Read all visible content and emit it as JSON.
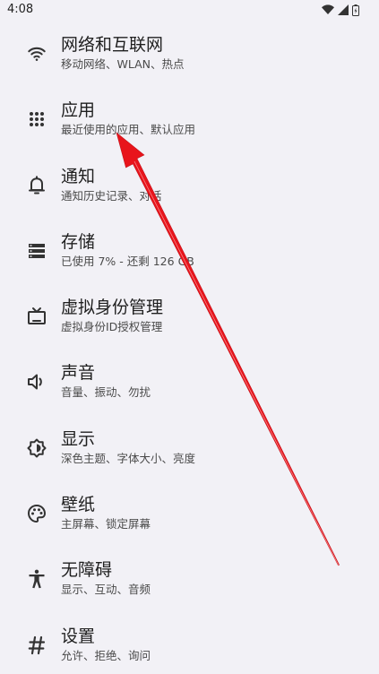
{
  "status_bar": {
    "time": "4:08",
    "icons": [
      "wifi-icon",
      "signal-icon",
      "battery-icon"
    ]
  },
  "settings": {
    "items": [
      {
        "name": "network",
        "icon": "wifi-icon",
        "title": "网络和互联网",
        "subtitle": "移动网络、WLAN、热点"
      },
      {
        "name": "apps",
        "icon": "apps-grid-icon",
        "title": "应用",
        "subtitle": "最近使用的应用、默认应用"
      },
      {
        "name": "notifications",
        "icon": "bell-icon",
        "title": "通知",
        "subtitle": "通知历史记录、对话"
      },
      {
        "name": "storage",
        "icon": "storage-icon",
        "title": "存储",
        "subtitle": "已使用 7% - 还剩 126 GB"
      },
      {
        "name": "virtual-identity",
        "icon": "tv-icon",
        "title": "虚拟身份管理",
        "subtitle": "虚拟身份ID授权管理"
      },
      {
        "name": "sound",
        "icon": "volume-icon",
        "title": "声音",
        "subtitle": "音量、振动、勿扰"
      },
      {
        "name": "display",
        "icon": "brightness-icon",
        "title": "显示",
        "subtitle": "深色主题、字体大小、亮度"
      },
      {
        "name": "wallpaper",
        "icon": "palette-icon",
        "title": "壁纸",
        "subtitle": "主屏幕、锁定屏幕"
      },
      {
        "name": "accessibility",
        "icon": "accessibility-icon",
        "title": "无障碍",
        "subtitle": "显示、互动、音频"
      },
      {
        "name": "privacy",
        "icon": "hash-icon",
        "title": "设置",
        "subtitle": "允许、拒绝、询问"
      }
    ]
  },
  "colors": {
    "background": "#f2f1f6",
    "text_primary": "#1f1f1f",
    "text_secondary": "#4a4a4a",
    "annotation_arrow": "#e8141b"
  },
  "annotation": {
    "type": "arrow",
    "points_to": "apps"
  }
}
